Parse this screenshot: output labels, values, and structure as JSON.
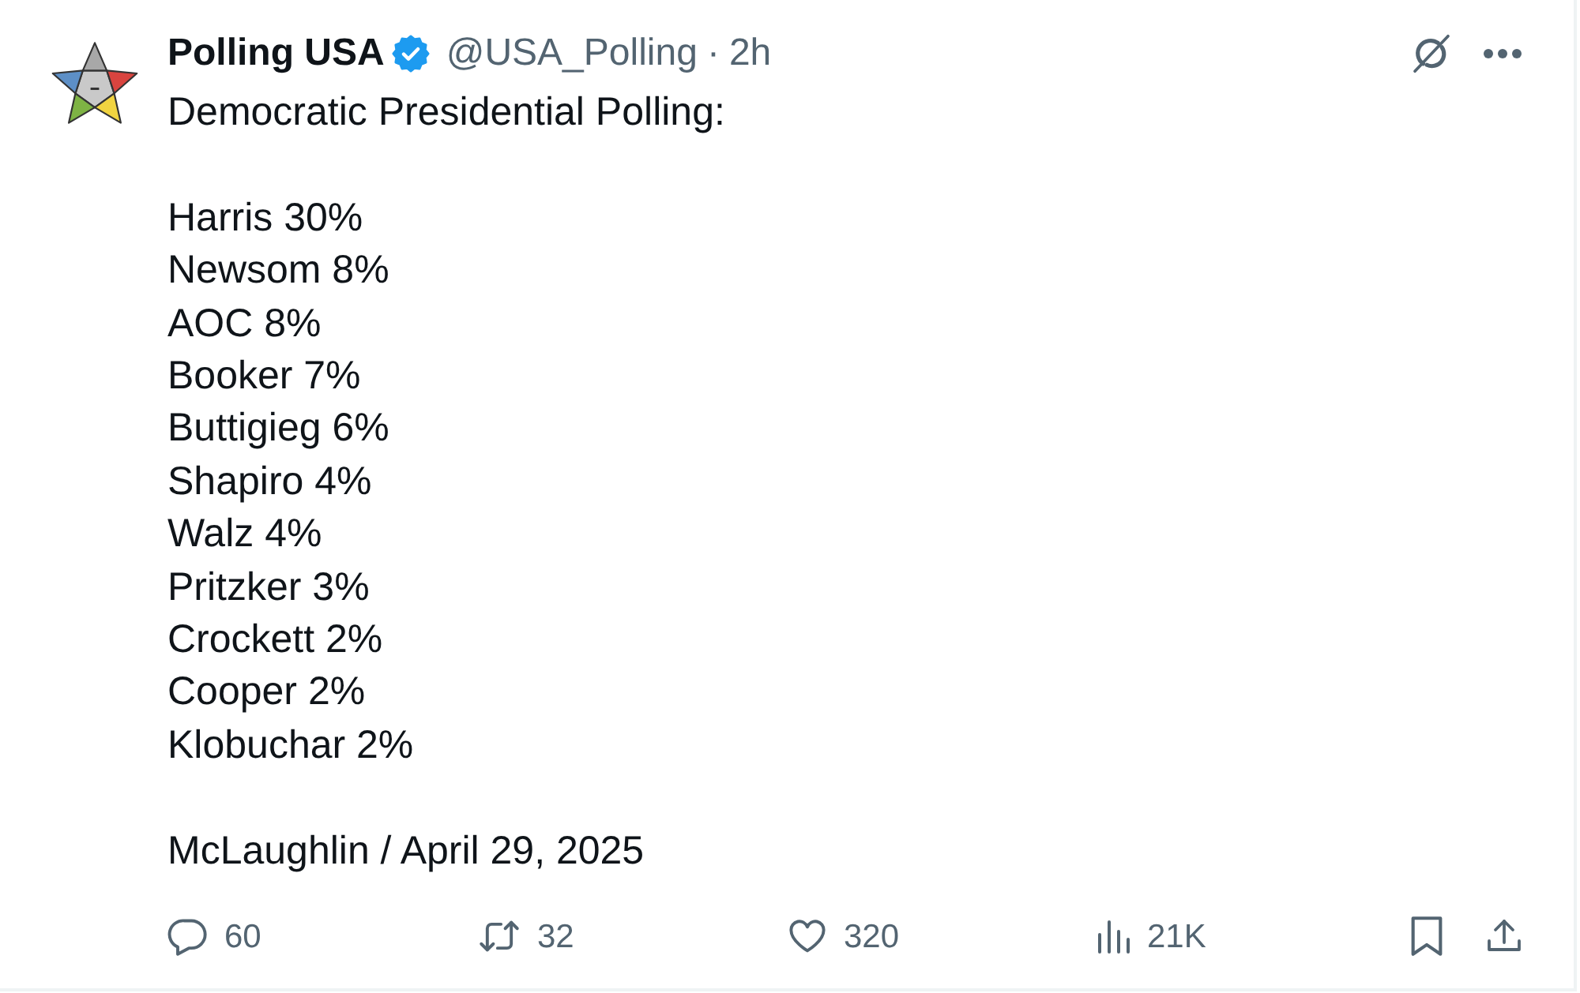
{
  "author": {
    "name": "Polling USA",
    "verified": true,
    "handle": "@USA_Polling",
    "separator": "·",
    "time": "2h"
  },
  "post": {
    "heading": "Democratic Presidential Polling:",
    "results": [
      "Harris 30%",
      "Newsom 8%",
      "AOC 8%",
      "Booker 7%",
      "Buttigieg 6%",
      "Shapiro 4%",
      "Walz 4%",
      "Pritzker 3%",
      "Crockett 2%",
      "Cooper 2%",
      "Klobuchar 2%"
    ],
    "source": "McLaughlin / April 29, 2025"
  },
  "actions": [
    {
      "kind": "reply",
      "count": "60"
    },
    {
      "kind": "repost",
      "count": "32"
    },
    {
      "kind": "like",
      "count": "320"
    },
    {
      "kind": "views",
      "count": "21K"
    },
    {
      "kind": "bookmark"
    },
    {
      "kind": "share"
    }
  ]
}
